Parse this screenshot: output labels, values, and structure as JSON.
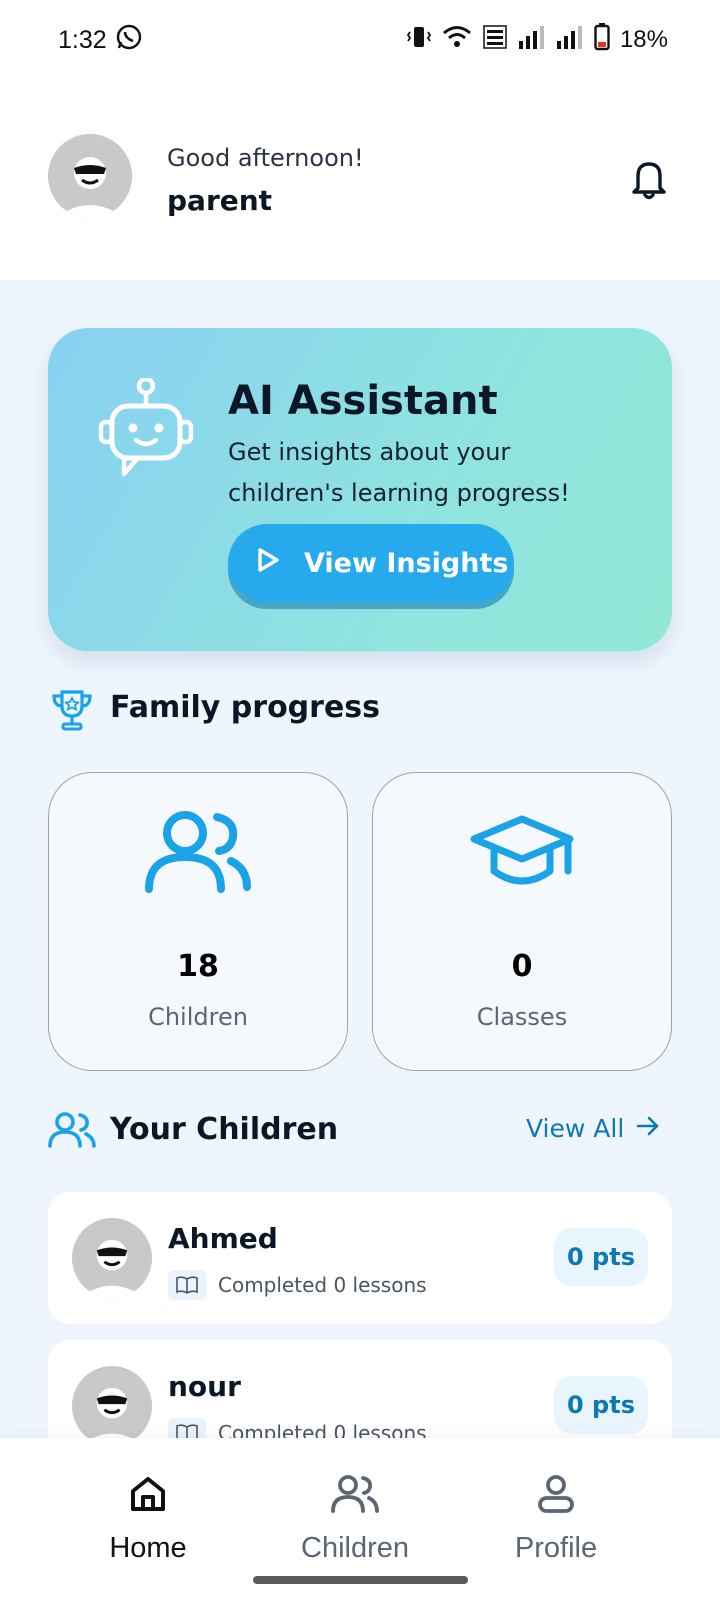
{
  "status_bar": {
    "time": "1:32",
    "battery": "18%"
  },
  "header": {
    "greeting": "Good afternoon!",
    "user_name": "parent"
  },
  "ai_assistant": {
    "title": "AI Assistant",
    "description": "Get insights about your children's learning progress!",
    "button_label": "View Insights"
  },
  "family_progress": {
    "title": "Family progress",
    "stats": [
      {
        "value": "18",
        "label": "Children",
        "icon": "users-icon"
      },
      {
        "value": "0",
        "label": "Classes",
        "icon": "graduation-cap-icon"
      }
    ]
  },
  "children_section": {
    "title": "Your Children",
    "view_all": "View All",
    "children": [
      {
        "name": "Ahmed",
        "progress": "Completed 0 lessons",
        "points": "0 pts"
      },
      {
        "name": "nour",
        "progress": "Completed 0 lessons",
        "points": "0 pts"
      }
    ]
  },
  "bottom_nav": {
    "items": [
      {
        "label": "Home",
        "icon": "home-icon",
        "active": true
      },
      {
        "label": "Children",
        "icon": "children-icon",
        "active": false
      },
      {
        "label": "Profile",
        "icon": "profile-icon",
        "active": false
      }
    ]
  },
  "colors": {
    "accent": "#27a9ee",
    "link": "#0e78b5",
    "background": "#eef5fd"
  }
}
